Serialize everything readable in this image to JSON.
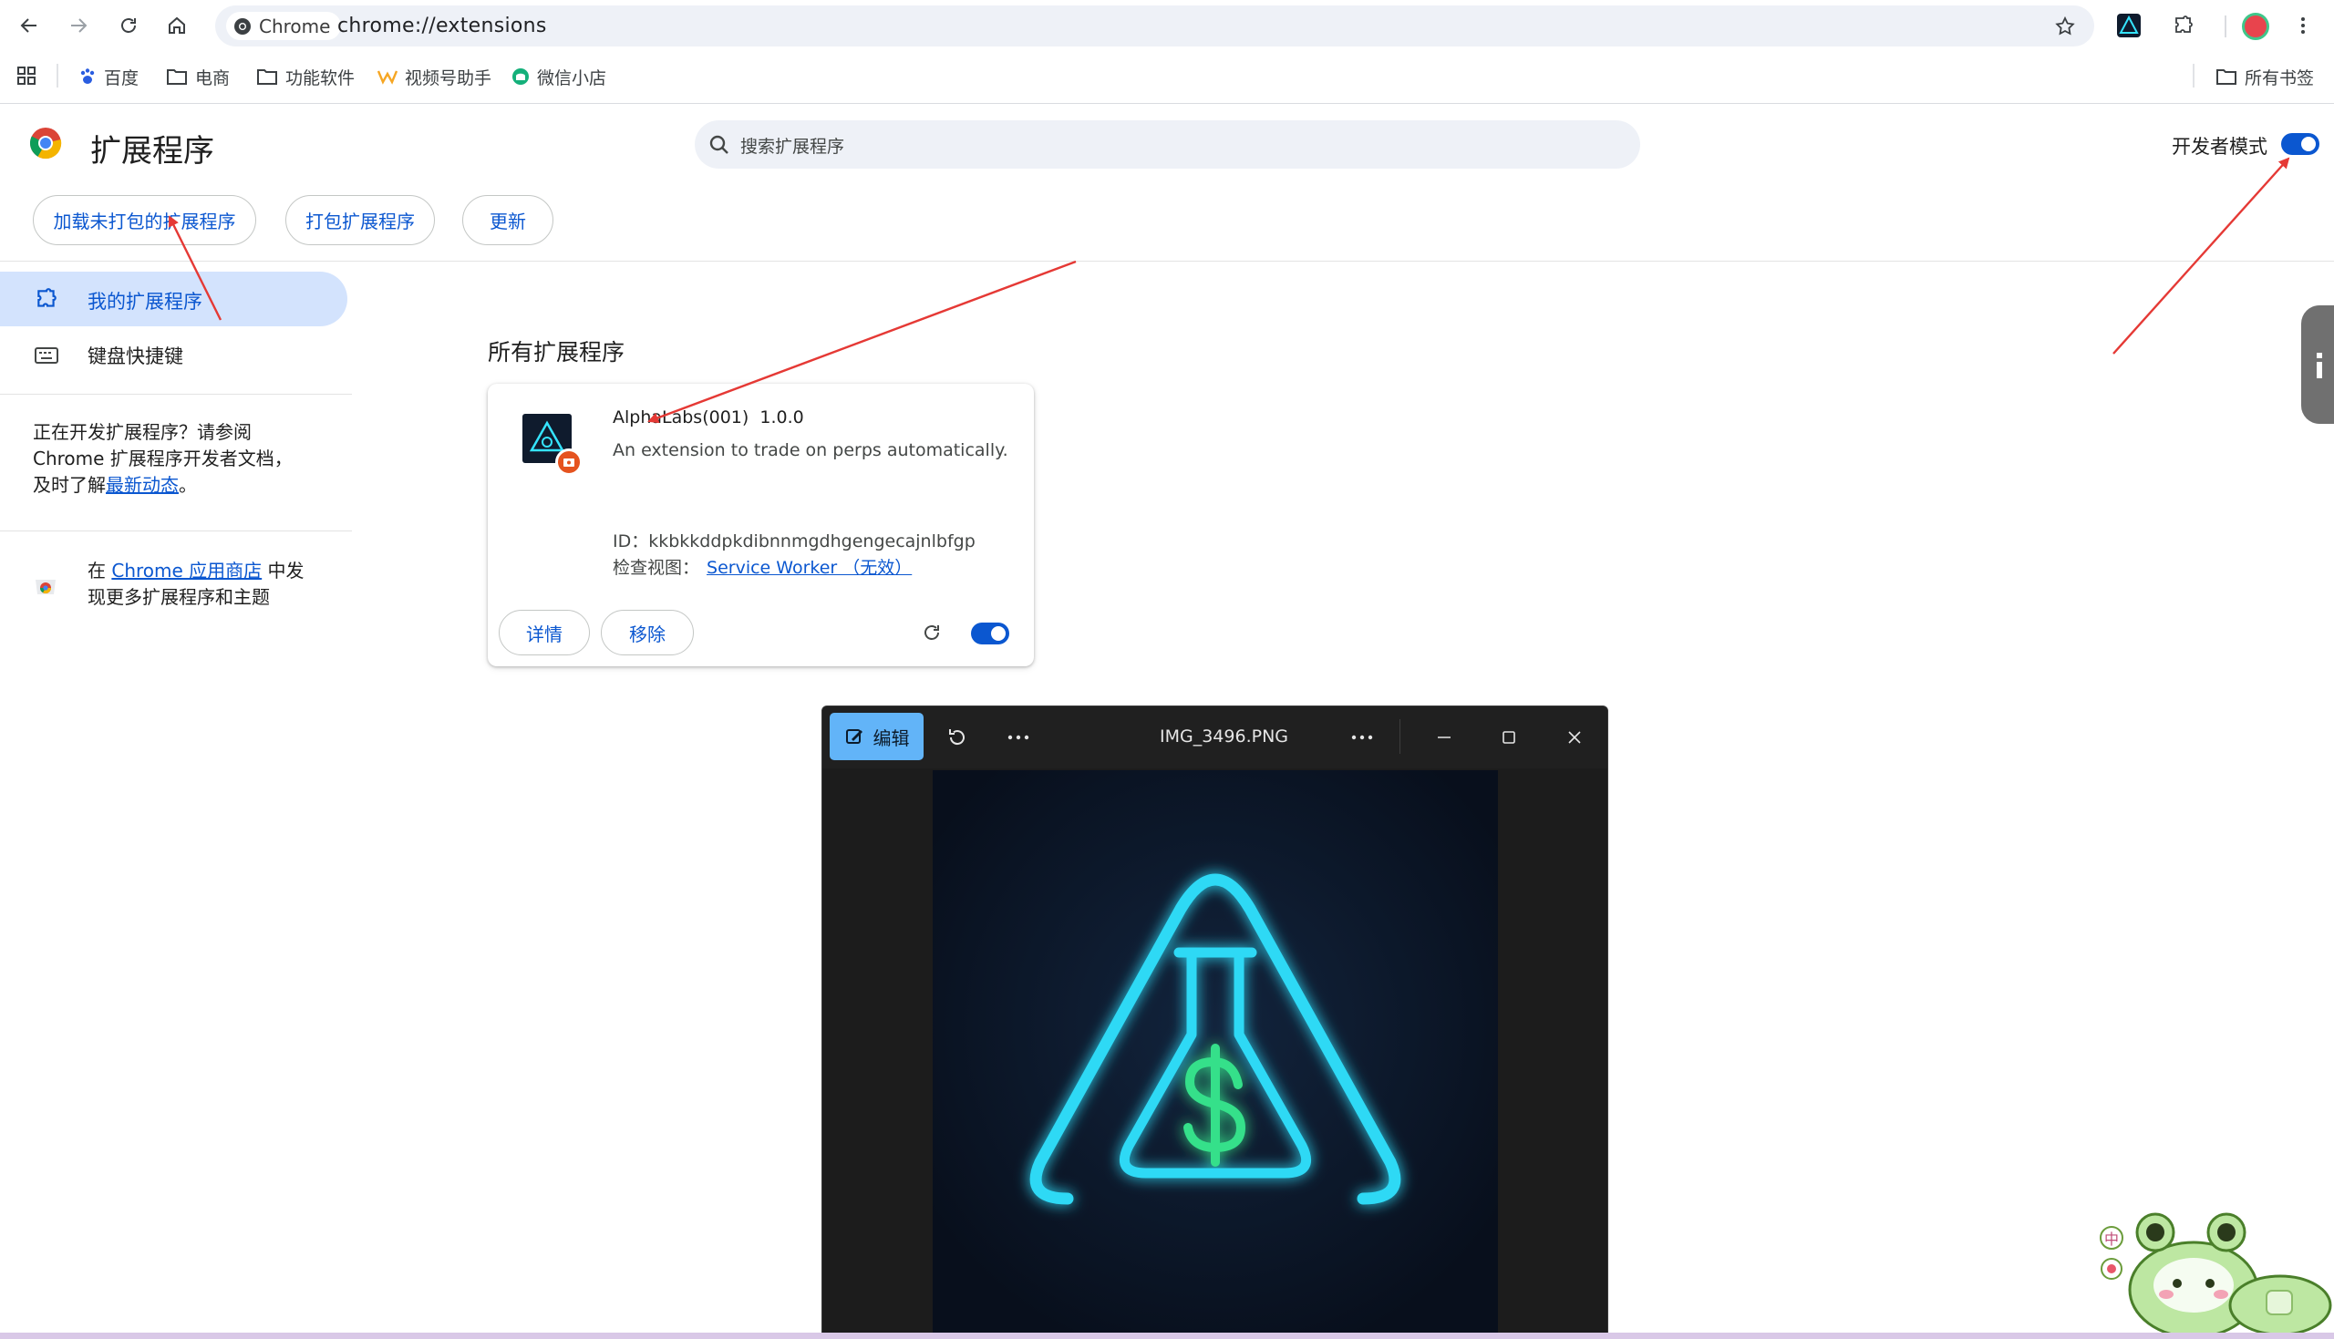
{
  "browser": {
    "chip_label": "Chrome",
    "url": "chrome://extensions",
    "bookmarks": [
      {
        "label": "百度",
        "icon": "baidu-paw-icon"
      },
      {
        "label": "电商",
        "icon": "folder-icon"
      },
      {
        "label": "功能软件",
        "icon": "folder-icon"
      },
      {
        "label": "视频号助手",
        "icon": "channels-logo-icon"
      },
      {
        "label": "微信小店",
        "icon": "wechat-store-icon"
      }
    ],
    "all_bookmarks": "所有书签"
  },
  "page": {
    "title": "扩展程序",
    "search_placeholder": "搜索扩展程序",
    "dev_mode_label": "开发者模式",
    "dev_mode_on": true,
    "actions": [
      "加载未打包的扩展程序",
      "打包扩展程序",
      "更新"
    ]
  },
  "sidebar": {
    "items": [
      {
        "label": "我的扩展程序",
        "icon": "puzzle-icon",
        "active": true
      },
      {
        "label": "键盘快捷键",
        "icon": "keyboard-icon",
        "active": false
      }
    ],
    "dev_note_line1": "正在开发扩展程序？请参阅",
    "dev_note_line2": "Chrome 扩展程序开发者文档，",
    "dev_note_line3_prefix": "及时了解",
    "dev_note_link": "最新动态",
    "dev_note_suffix": "。",
    "store_prefix": "在 ",
    "store_link": "Chrome 应用商店",
    "store_suffix": " 中发",
    "store_line2": "现更多扩展程序和主题"
  },
  "main": {
    "section_title": "所有扩展程序",
    "extension": {
      "name": "AlphaLabs(001)",
      "version": "1.0.0",
      "description": "An extension to trade on perps automatically.",
      "id_label": "ID：",
      "id": "kkbkkddpkdibnnmgdhgengecajnlbfgp",
      "inspect_label": "检查视图：",
      "inspect_link": "Service Worker （无效）",
      "details_button": "详情",
      "remove_button": "移除",
      "enabled": true
    }
  },
  "viewer": {
    "edit_label": "编辑",
    "file_name": "IMG_3496.PNG"
  },
  "colors": {
    "accent": "#0b57d0",
    "annotation_arrow": "#e53935",
    "neon": "#35e4ff",
    "dollar": "#34e08a"
  }
}
